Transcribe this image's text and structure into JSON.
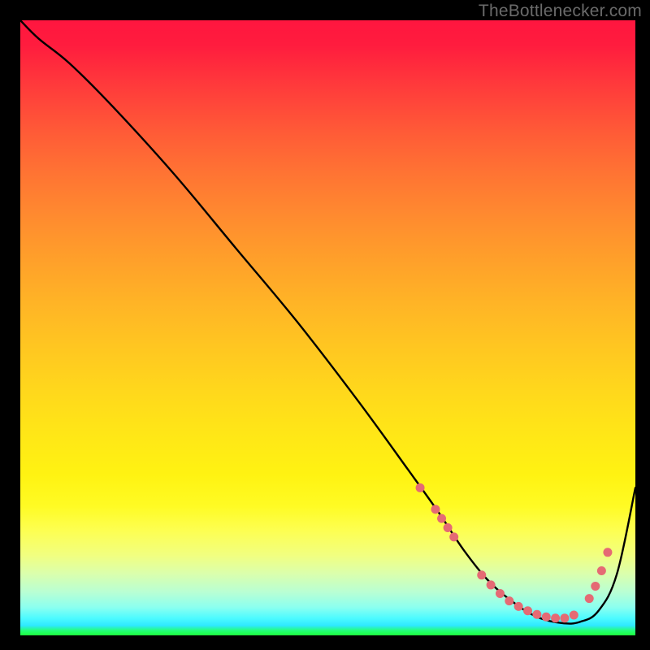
{
  "watermark": "TheBottlenecker.com",
  "chart_data": {
    "type": "line",
    "title": "",
    "xlabel": "",
    "ylabel": "",
    "xlim": [
      0,
      100
    ],
    "ylim": [
      0,
      100
    ],
    "series": [
      {
        "name": "bottleneck-curve",
        "x": [
          0,
          3,
          8,
          15,
          25,
          35,
          45,
          55,
          63,
          68,
          72,
          76,
          80,
          84,
          88,
          91,
          94,
          97,
          100
        ],
        "y": [
          100,
          97,
          93,
          86,
          75,
          63,
          51,
          38,
          27,
          20,
          14,
          9,
          5.5,
          3,
          2,
          2.2,
          4,
          10,
          24
        ]
      }
    ],
    "markers": [
      {
        "x": 65.0,
        "y": 24.0
      },
      {
        "x": 67.5,
        "y": 20.5
      },
      {
        "x": 68.5,
        "y": 19.0
      },
      {
        "x": 69.5,
        "y": 17.5
      },
      {
        "x": 70.5,
        "y": 16.0
      },
      {
        "x": 75.0,
        "y": 9.8
      },
      {
        "x": 76.5,
        "y": 8.2
      },
      {
        "x": 78.0,
        "y": 6.8
      },
      {
        "x": 79.5,
        "y": 5.6
      },
      {
        "x": 81.0,
        "y": 4.7
      },
      {
        "x": 82.5,
        "y": 4.0
      },
      {
        "x": 84.0,
        "y": 3.4
      },
      {
        "x": 85.5,
        "y": 3.0
      },
      {
        "x": 87.0,
        "y": 2.8
      },
      {
        "x": 88.5,
        "y": 2.8
      },
      {
        "x": 90.0,
        "y": 3.3
      },
      {
        "x": 92.5,
        "y": 6.0
      },
      {
        "x": 93.5,
        "y": 8.0
      },
      {
        "x": 94.5,
        "y": 10.5
      },
      {
        "x": 95.5,
        "y": 13.5
      }
    ],
    "marker_color": "#e56a74",
    "curve_color": "#000000"
  }
}
